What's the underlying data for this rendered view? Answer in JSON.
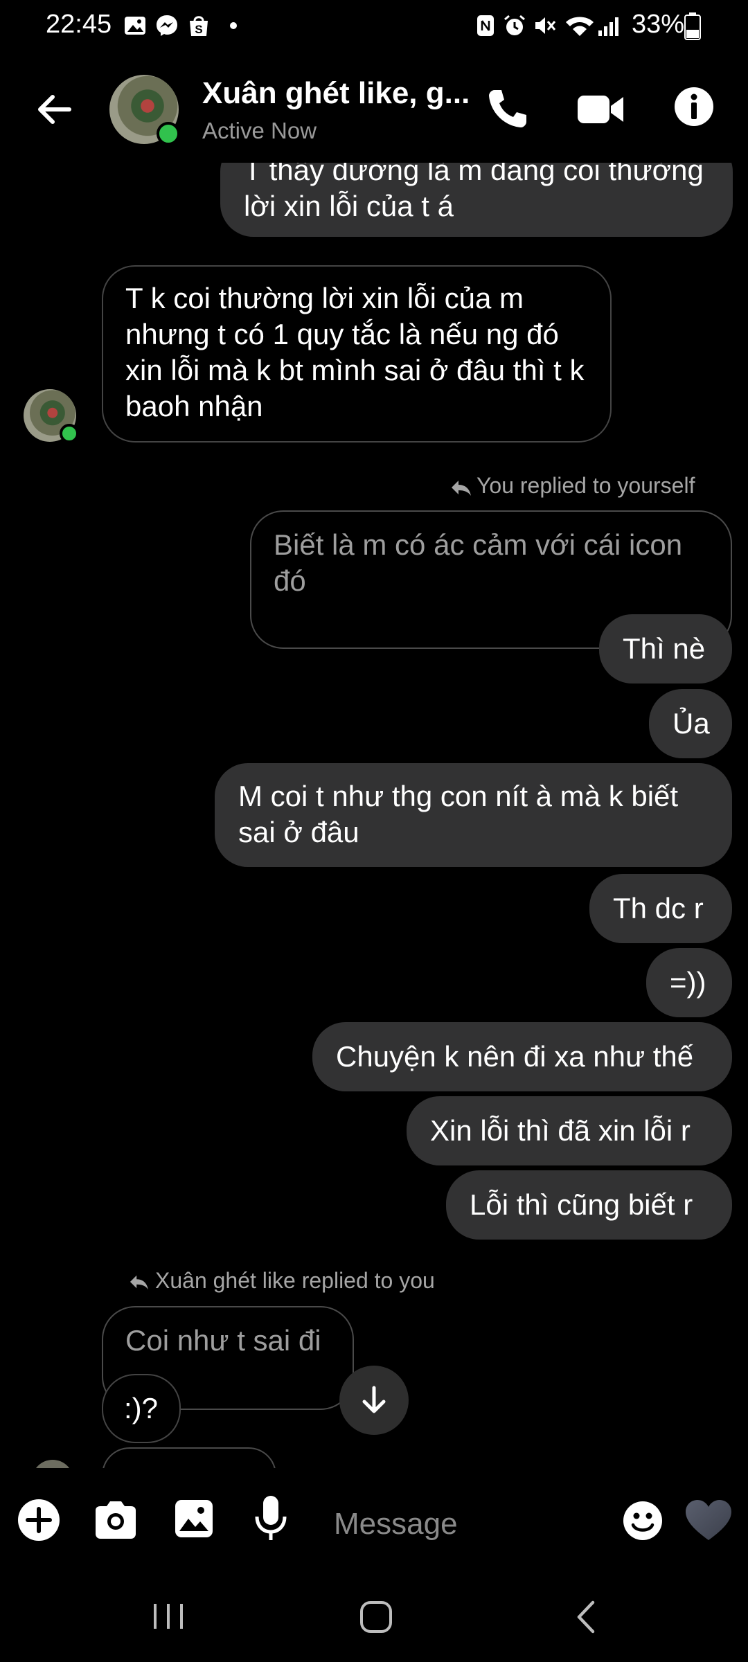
{
  "status_bar": {
    "time": "22:45",
    "battery": "33%",
    "left_icons": [
      "gallery-icon",
      "messenger-icon",
      "shopee-icon",
      "dot-icon"
    ],
    "right_icons": [
      "nfc-icon",
      "alarm-icon",
      "mute-icon",
      "wifi-icon",
      "signal-icon",
      "battery-icon"
    ]
  },
  "header": {
    "contact_name": "Xuân ghét like, g...",
    "status": "Active Now",
    "icons": [
      "back-arrow-icon",
      "phone-icon",
      "video-icon",
      "info-icon"
    ]
  },
  "messages": {
    "m1": "T thấy dường là m đang coi thường lời xin lỗi của t á",
    "m2": "T k coi thường lời xin lỗi của m nhưng t có 1 quy tắc là nếu ng đó xin lỗi mà k bt mình sai ở đâu thì t k baoh nhận",
    "reply_note_1": "You replied to yourself",
    "quoted_1": "Biết là m có ác cảm với cái icon đó",
    "m3": "Thì nè",
    "m4": "Ủa",
    "m5": "M coi t như thg con nít à mà k biết sai ở đâu",
    "m6": "Th dc r",
    "m7": "=))",
    "m8": "Chuyện k nên đi xa như thế",
    "m9": "Xin lỗi thì đã xin lỗi r",
    "m10": "Lỗi thì cũng biết r",
    "reply_note_2": "Xuân ghét like replied to you",
    "quoted_2": "Coi như t sai đi",
    "m11": ":)?"
  },
  "composer": {
    "placeholder": "Message",
    "icons": [
      "plus-icon",
      "camera-icon",
      "image-icon",
      "microphone-icon",
      "emoji-icon",
      "heart-icon"
    ]
  },
  "colors": {
    "background": "#000000",
    "outgoing_bubble": "#323233",
    "online": "#31c24d",
    "muted_text": "#9a9a9a"
  }
}
